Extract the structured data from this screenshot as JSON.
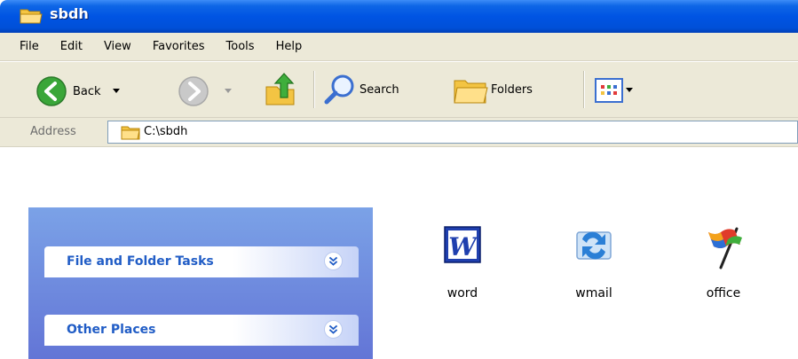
{
  "window": {
    "title": "sbdh"
  },
  "menu": [
    "File",
    "Edit",
    "View",
    "Favorites",
    "Tools",
    "Help"
  ],
  "toolbar": {
    "back_label": "Back",
    "search_label": "Search",
    "folders_label": "Folders"
  },
  "address": {
    "label": "Address",
    "value": "C:\\sbdh"
  },
  "tasks": {
    "groups": [
      {
        "title": "File and Folder Tasks"
      },
      {
        "title": "Other Places"
      }
    ]
  },
  "files": [
    {
      "name": "word",
      "icon": "word-icon"
    },
    {
      "name": "wmail",
      "icon": "wmail-icon"
    },
    {
      "name": "office",
      "icon": "office-icon"
    }
  ],
  "colors": {
    "titlebar": "#0054e3",
    "chrome": "#ece9d8",
    "taskpane": "#6375d6",
    "group_title": "#215dc6"
  }
}
